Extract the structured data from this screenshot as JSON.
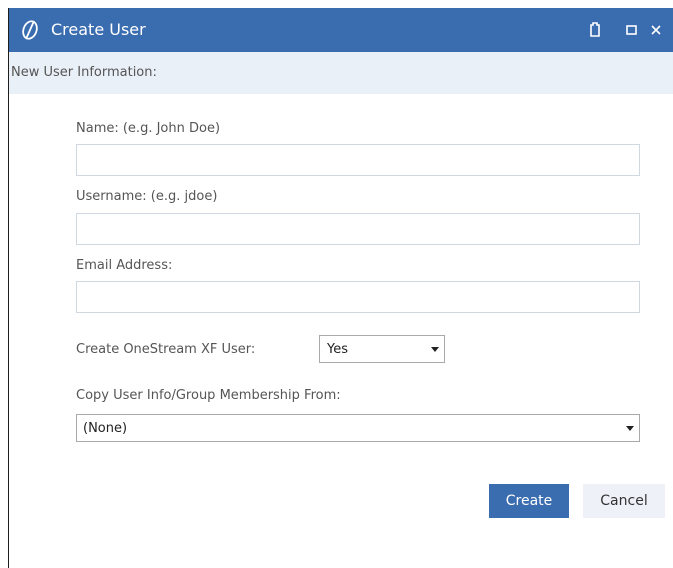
{
  "window": {
    "title": "Create User",
    "logo_icon": "onestream-logo-icon",
    "controls": [
      "pin-icon",
      "maximize-icon",
      "close-icon"
    ],
    "titlebar_color": "#3a6cb0"
  },
  "section": {
    "title": "New User Information:"
  },
  "form": {
    "name": {
      "label": "Name: (e.g. John Doe)",
      "value": ""
    },
    "username": {
      "label": "Username: (e.g. jdoe)",
      "value": ""
    },
    "email": {
      "label": "Email Address:",
      "value": ""
    },
    "create_xf_user": {
      "label": "Create OneStream XF User:",
      "selected": "Yes"
    },
    "copy_from": {
      "label": "Copy User Info/Group Membership From:",
      "selected": "(None)"
    }
  },
  "buttons": {
    "create": "Create",
    "cancel": "Cancel"
  },
  "colors": {
    "accent": "#3a6cb0",
    "section_bg": "#eaf0f8"
  }
}
